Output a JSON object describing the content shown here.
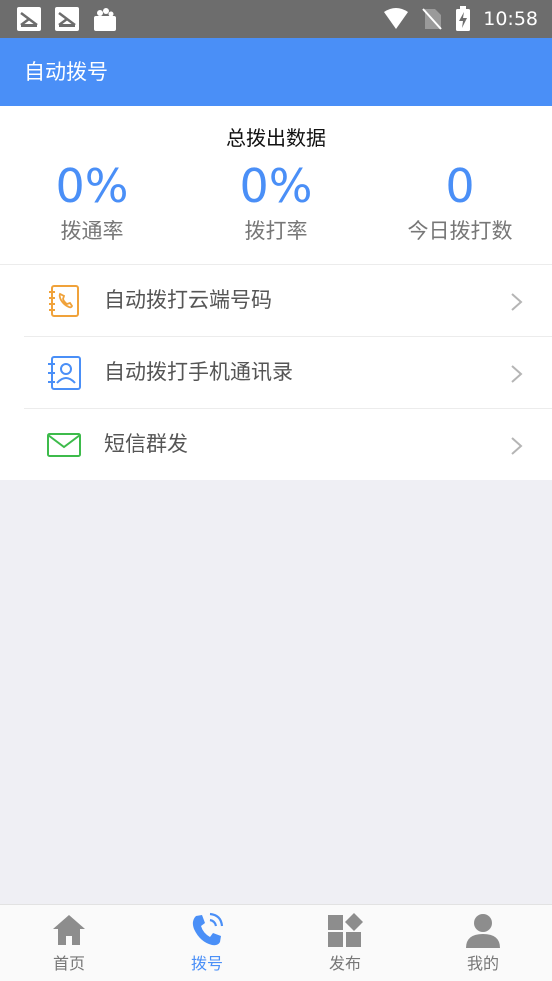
{
  "status_bar": {
    "time": "10:58",
    "left_icons": [
      "notification-app-icon",
      "notification-app-icon",
      "notification-bag-icon"
    ],
    "right_icons": [
      "wifi-icon",
      "no-sim-icon",
      "battery-charging-icon"
    ]
  },
  "app_bar": {
    "title": "自动拨号"
  },
  "stats": {
    "title": "总拨出数据",
    "items": [
      {
        "value": "0%",
        "label": "拨通率"
      },
      {
        "value": "0%",
        "label": "拨打率"
      },
      {
        "value": "0",
        "label": "今日拨打数"
      }
    ]
  },
  "menu": {
    "items": [
      {
        "label": "自动拨打云端号码",
        "icon": "phone-book-icon",
        "color": "#f0a23a"
      },
      {
        "label": "自动拨打手机通讯录",
        "icon": "contacts-icon",
        "color": "#4a8ff7"
      },
      {
        "label": "短信群发",
        "icon": "envelope-icon",
        "color": "#3dbb4b"
      }
    ]
  },
  "tabbar": {
    "active_color": "#4a8ff7",
    "tabs": [
      {
        "label": "首页",
        "icon": "home-icon",
        "active": false
      },
      {
        "label": "拨号",
        "icon": "phone-call-icon",
        "active": true
      },
      {
        "label": "发布",
        "icon": "publish-grid-icon",
        "active": false
      },
      {
        "label": "我的",
        "icon": "profile-icon",
        "active": false
      }
    ]
  },
  "colors": {
    "accent": "#4a8ff7",
    "status_bar": "#6d6d6d",
    "background": "#efeff4"
  }
}
